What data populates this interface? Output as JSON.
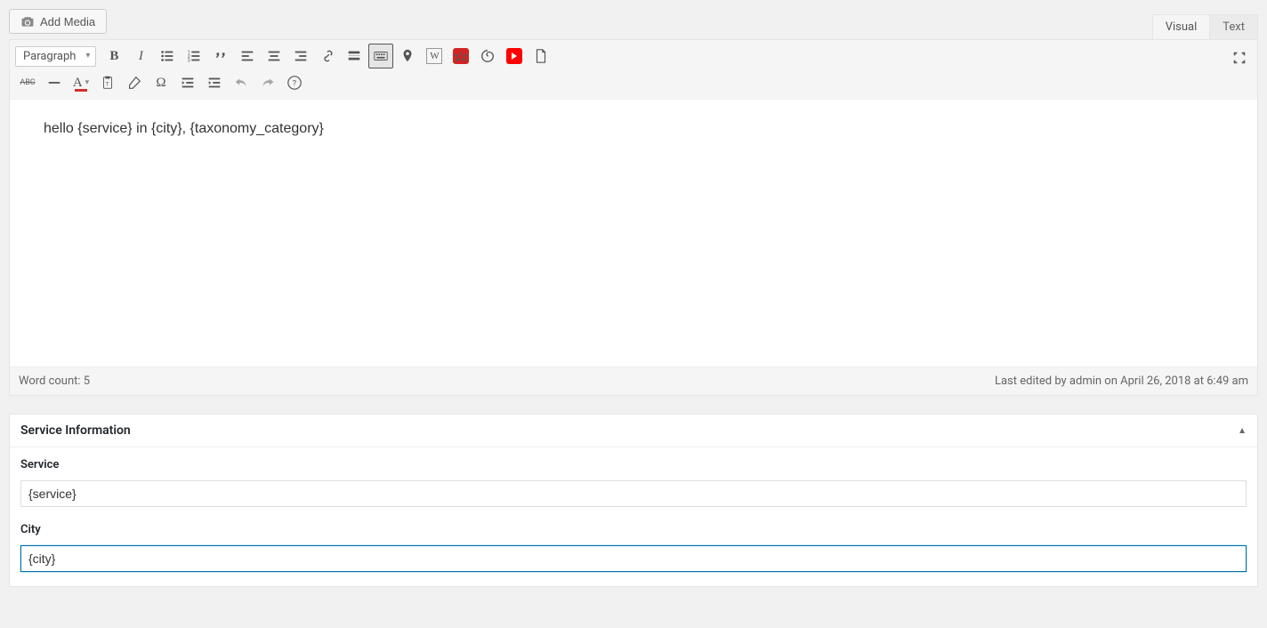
{
  "media_button_label": "Add Media",
  "editor_tabs": {
    "visual": "Visual",
    "text": "Text"
  },
  "format_select": "Paragraph",
  "editor_content": "hello {service} in {city}, {taxonomy_category}",
  "status": {
    "word_count_label": "Word count: ",
    "word_count_value": "5",
    "last_edited": "Last edited by admin on April 26, 2018 at 6:49 am"
  },
  "metabox": {
    "title": "Service Information",
    "fields": {
      "service": {
        "label": "Service",
        "value": "{service}"
      },
      "city": {
        "label": "City",
        "value": "{city}"
      }
    }
  },
  "icons": {
    "wiki": "W"
  }
}
